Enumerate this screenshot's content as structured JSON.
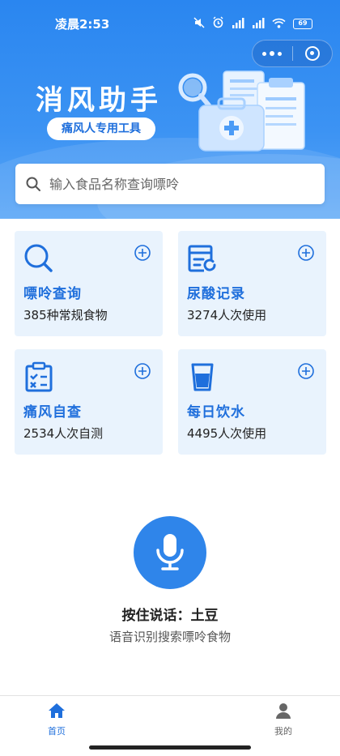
{
  "status_bar": {
    "time": "凌晨2:53",
    "battery": "69"
  },
  "header": {
    "title": "消风助手",
    "subtitle": "痛风人专用工具"
  },
  "search": {
    "placeholder": "输入食品名称查询嘌呤"
  },
  "cards": [
    {
      "title": "嘌呤查询",
      "subtitle": "385种常规食物",
      "icon": "magnifier-icon"
    },
    {
      "title": "尿酸记录",
      "subtitle": "3274人次使用",
      "icon": "record-icon"
    },
    {
      "title": "痛风自查",
      "subtitle": "2534人次自测",
      "icon": "checklist-icon"
    },
    {
      "title": "每日饮水",
      "subtitle": "4495人次使用",
      "icon": "water-cup-icon"
    }
  ],
  "voice": {
    "title": "按住说话：土豆",
    "subtitle": "语音识别搜索嘌呤食物"
  },
  "tabbar": {
    "home": "首页",
    "mine": "我的"
  },
  "colors": {
    "primary": "#1f6fdc",
    "header_bg": "#2a86f0",
    "card_bg": "#e9f3fd",
    "mic_bg": "#2f85ea"
  }
}
